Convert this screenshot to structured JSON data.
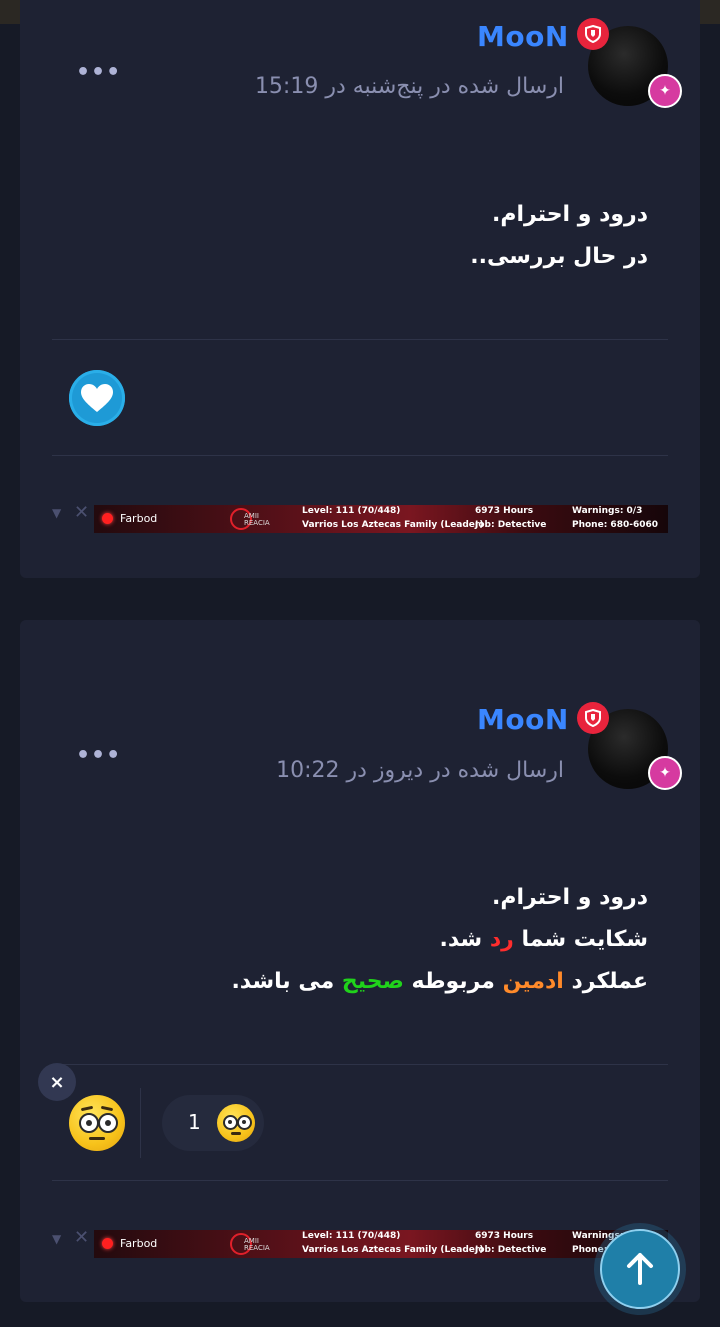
{
  "top_bar": {},
  "posts": [
    {
      "author": "MooN",
      "meta": "ارسال شده در پنج‌شنبه در 15:19",
      "more": "•••",
      "body_lines": [
        "درود و احترام.",
        "در حال بررسی.."
      ],
      "reaction_icon": "heart-icon"
    },
    {
      "author": "MooN",
      "meta": "ارسال شده در دیروز در 10:22",
      "more": "•••",
      "body": {
        "line1": "درود و احترام.",
        "line2_before": "شکایت شما ",
        "line2_red": "رد",
        "line2_after": " شد.",
        "line3_before": "عملکرد ",
        "line3_orange": "ادمین",
        "line3_mid": " مربوطه ",
        "line3_green": "صحیح",
        "line3_after": " می باشد."
      },
      "reaction_close": "×",
      "reaction_count": "1",
      "reaction_icon": "confused-emoji"
    }
  ],
  "signature": {
    "name": "Farbod",
    "logo_text_1": "AMII",
    "logo_text_2": "REACIA",
    "level": "Level: 111 (70/448)",
    "family": "Varrios Los Aztecas Family (Leader)",
    "hours": "6973 Hours",
    "job": "Job: Detective",
    "warnings": "Warnings: 0/3",
    "phone": "Phone: 680-6060"
  },
  "colors": {
    "username": "#3a86ff",
    "rejected": "#ff2d2d",
    "admin": "#ff8a2a",
    "correct": "#20d21b",
    "badge": "#e8243c"
  }
}
